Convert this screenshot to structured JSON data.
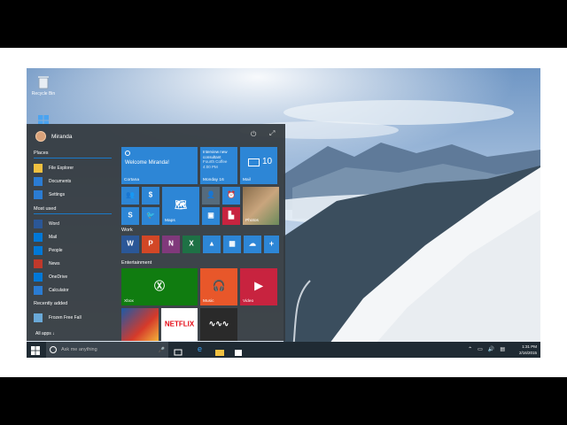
{
  "desktop": {
    "icons": [
      {
        "label": "Recycle Bin",
        "icon": "recycle-bin-icon"
      },
      {
        "label": "",
        "icon": "windows-logo-icon"
      }
    ]
  },
  "start_menu": {
    "user_name": "Miranda",
    "places": {
      "title": "Places",
      "items": [
        {
          "label": "File Explorer",
          "icon": "folder-icon",
          "color": "#f0c040"
        },
        {
          "label": "Documents",
          "icon": "documents-icon",
          "color": "#2b7cd3"
        },
        {
          "label": "Settings",
          "icon": "gear-icon",
          "color": "#2b7cd3"
        }
      ]
    },
    "most_used": {
      "title": "Most used",
      "items": [
        {
          "label": "Word",
          "icon": "word-icon",
          "color": "#2b5797"
        },
        {
          "label": "Mail",
          "icon": "mail-icon",
          "color": "#0078d7"
        },
        {
          "label": "People",
          "icon": "people-icon",
          "color": "#0078d7"
        },
        {
          "label": "News",
          "icon": "news-icon",
          "color": "#c0392b"
        },
        {
          "label": "OneDrive",
          "icon": "onedrive-icon",
          "color": "#0078d7"
        },
        {
          "label": "Calculator",
          "icon": "calculator-icon",
          "color": "#2b7cd3"
        }
      ]
    },
    "recently_added": {
      "title": "Recently added",
      "items": [
        {
          "label": "Frozen Free Fall",
          "icon": "frozen-icon",
          "color": "#6aa9d8"
        }
      ]
    },
    "all_apps": "All apps ↓",
    "tiles": {
      "cortana": {
        "welcome": "Welcome Miranda!",
        "label": "Cortana"
      },
      "calendar": {
        "line1": "Interview new",
        "line2": "consultant",
        "line3": "Fourth Coffee",
        "line4": "4:00 PM",
        "label": "Monday 16"
      },
      "mail": {
        "count": "10",
        "label": "Mail"
      },
      "maps": {
        "label": "Maps"
      },
      "photos": {
        "label": "Photos"
      },
      "work_title": "Work",
      "entertainment_title": "Entertainment",
      "xbox": {
        "label": "Xbox"
      },
      "music": {
        "label": "Music"
      },
      "video": {
        "label": "Video"
      },
      "netflix": {
        "label": "NETFLIX"
      }
    }
  },
  "taskbar": {
    "search_placeholder": "Ask me anything",
    "time": "1:31 PM",
    "date": "2/16/2015"
  },
  "colors": {
    "accent": "#1a7ac9",
    "tile_blue": "#2d86d6",
    "xbox_green": "#107c10",
    "music_orange": "#e8572a",
    "video_red": "#c8233f",
    "netflix_red": "#e50914"
  }
}
